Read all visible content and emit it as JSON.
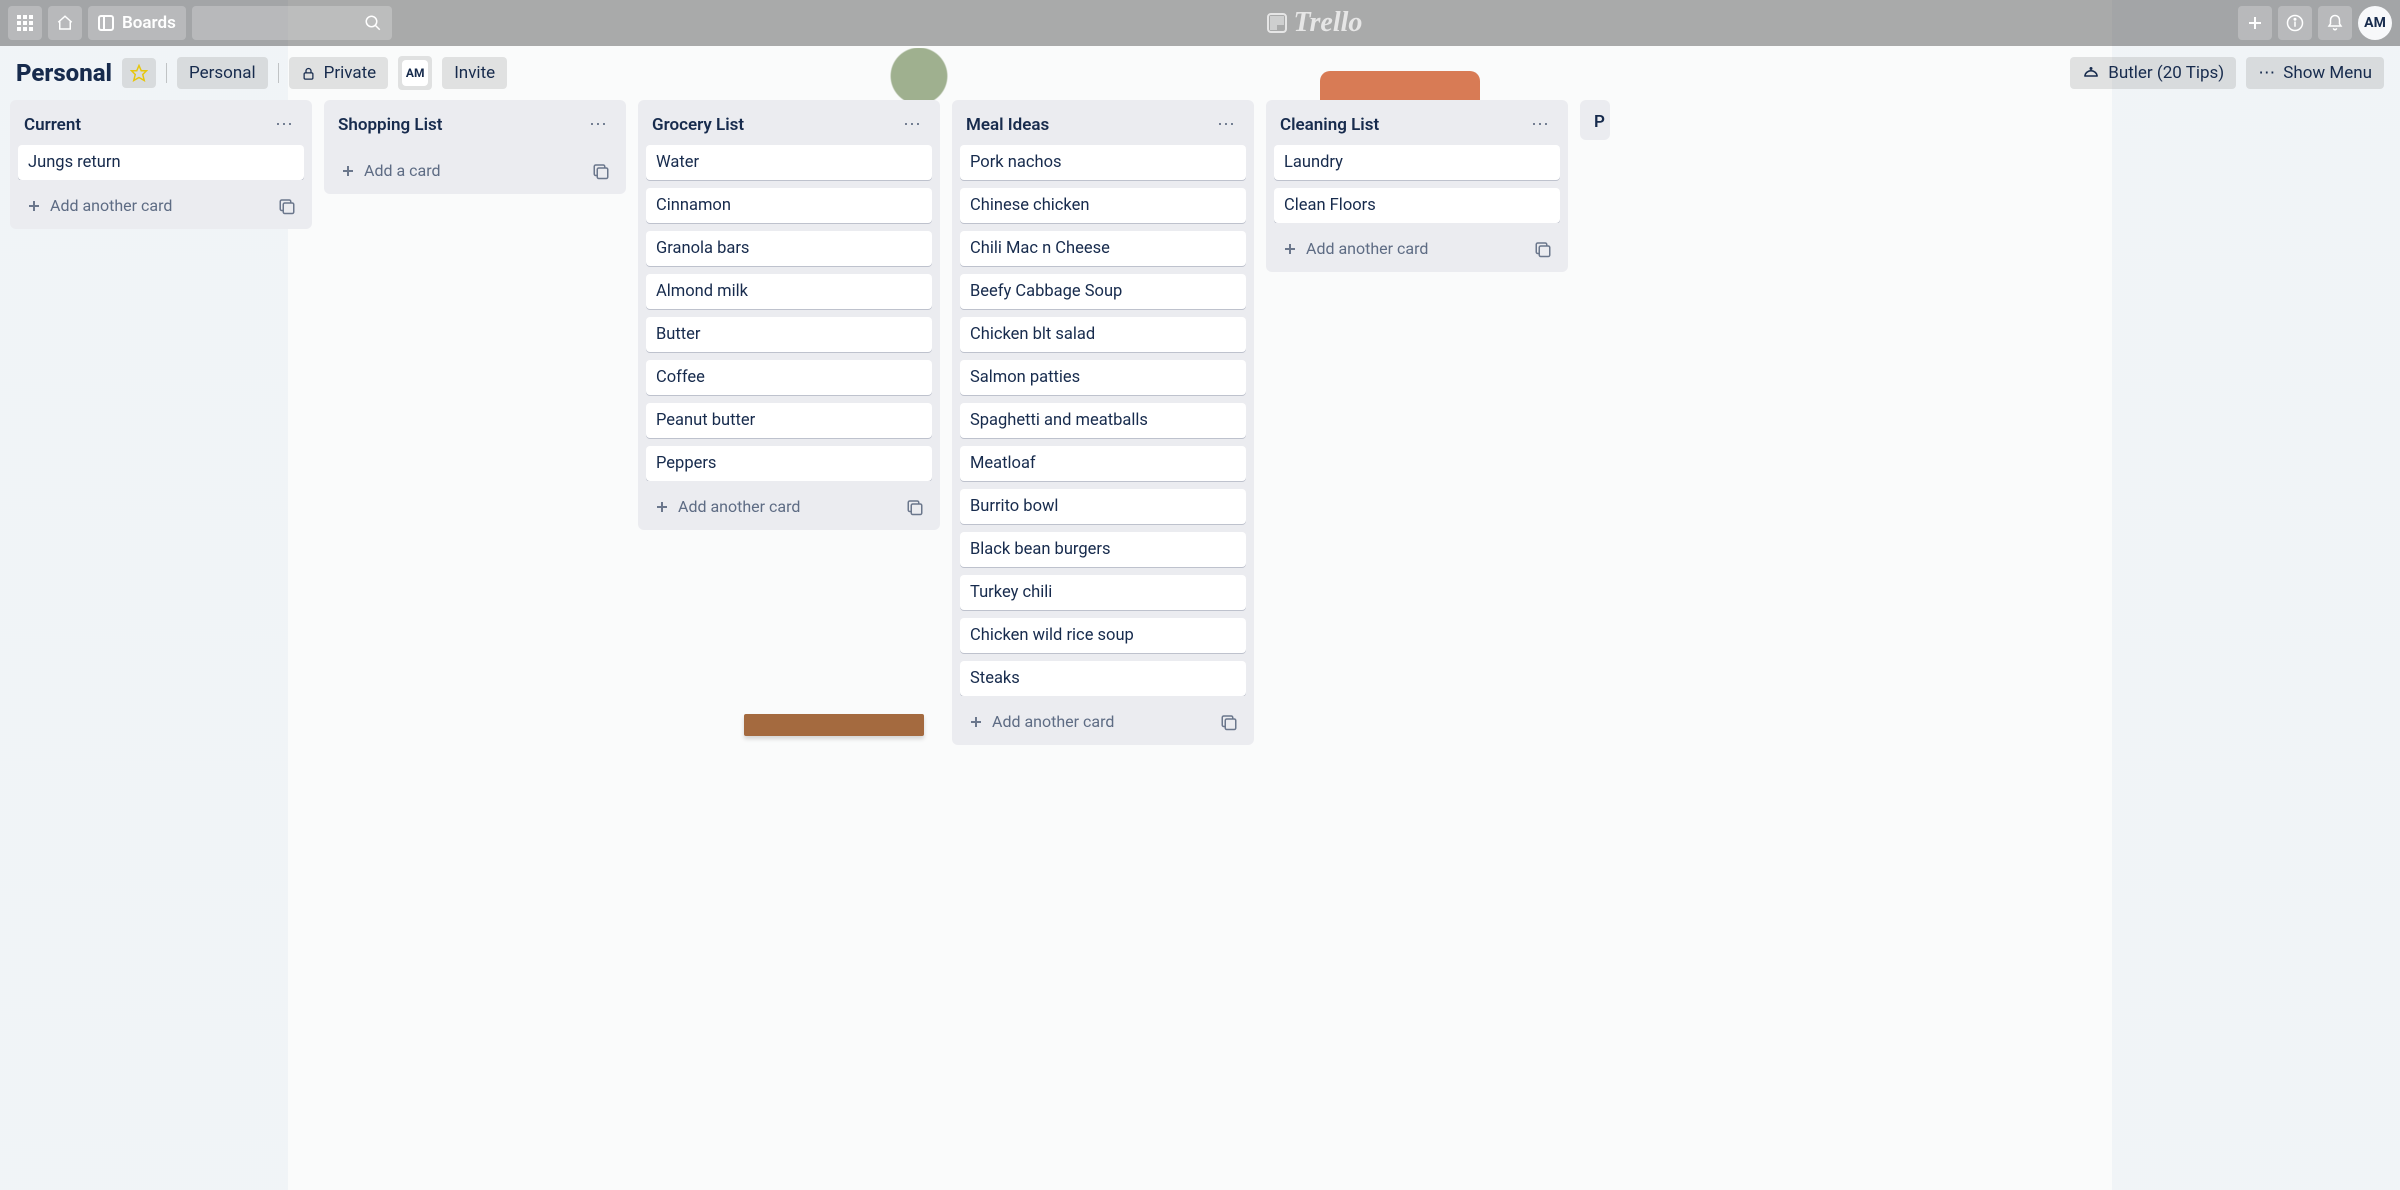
{
  "app": {
    "name": "Trello"
  },
  "topbar": {
    "boards_label": "Boards",
    "user_initials": "AM"
  },
  "board_header": {
    "title": "Personal",
    "team_label": "Personal",
    "visibility_label": "Private",
    "member_initials": "AM",
    "invite_label": "Invite",
    "butler_label": "Butler (20 Tips)",
    "show_menu_label": "Show Menu"
  },
  "lists": [
    {
      "title": "Current",
      "cards": [
        "Jungs return"
      ],
      "add_label": "Add another card",
      "add_first": false
    },
    {
      "title": "Shopping List",
      "cards": [],
      "add_label": "Add a card",
      "add_first": true
    },
    {
      "title": "Grocery List",
      "cards": [
        "Water",
        "Cinnamon",
        "Granola bars",
        "Almond milk",
        "Butter",
        "Coffee",
        "Peanut butter",
        "Peppers"
      ],
      "add_label": "Add another card",
      "add_first": false
    },
    {
      "title": "Meal Ideas",
      "cards": [
        "Pork nachos",
        "Chinese chicken",
        "Chili Mac n Cheese",
        "Beefy Cabbage Soup",
        "Chicken blt salad",
        "Salmon patties",
        "Spaghetti and meatballs",
        "Meatloaf",
        "Burrito bowl",
        "Black bean burgers",
        "Turkey chili",
        "Chicken wild rice soup",
        "Steaks"
      ],
      "add_label": "Add another card",
      "add_first": false
    },
    {
      "title": "Cleaning List",
      "cards": [
        "Laundry",
        "Clean Floors"
      ],
      "add_label": "Add another card",
      "add_first": false
    },
    {
      "title": "P",
      "cards": [],
      "add_label": "",
      "peek": true
    }
  ]
}
